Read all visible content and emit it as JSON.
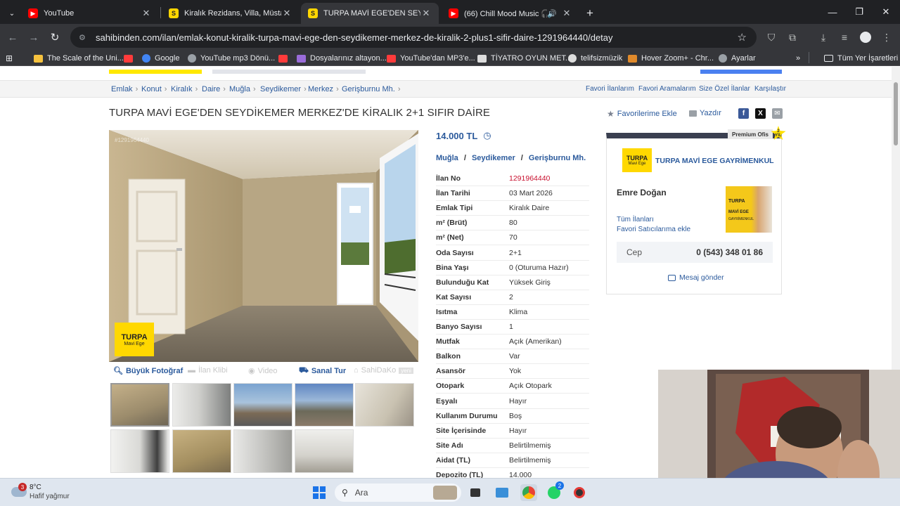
{
  "tabs": [
    {
      "title": "YouTube",
      "close": "✕"
    },
    {
      "title": "Kiralık Rezidans, Villa, Müstakil Ev",
      "close": "✕"
    },
    {
      "title": "TURPA MAVİ EGE'DEN SEYDİKEMER",
      "close": "✕"
    },
    {
      "title": "(66) Chill Mood Music 🎧 –",
      "close": "✕"
    }
  ],
  "new_tab": "+",
  "window_controls": {
    "minimize": "—",
    "restore": "❐",
    "close": "✕"
  },
  "address": {
    "url": "sahibinden.com/ilan/emlak-konut-kiralik-turpa-mavi-ege-den-seydikemer-merkez-de-kiralik-2-plus1-sifir-daire-1291964440/detay"
  },
  "bookmarks": [
    {
      "label": "The Scale of the Uni...",
      "color": "#f6c23e"
    },
    {
      "label": "Google",
      "color": "#4285f4"
    },
    {
      "label": "YouTube mp3 Dönü...",
      "color": "#9aa0a6"
    },
    {
      "label": "Dosyalarınız altayon...",
      "color": "#9a6cd9"
    },
    {
      "label": "YouTube'dan MP3'e...",
      "color": "#ff3b3b"
    },
    {
      "label": "TİYATRO OYUN MET...",
      "color": "#dddddd"
    },
    {
      "label": "telifsizmüzik",
      "color": "#dddddd"
    },
    {
      "label": "Hover Zoom+ - Chr...",
      "color": "#e08a2b"
    },
    {
      "label": "Ayarlar",
      "color": "#9aa0a6"
    }
  ],
  "bookmarks_more": "»",
  "all_bookmarks": "Tüm Yer İşaretleri",
  "breadcrumb": [
    "Emlak",
    "Konut",
    "Kiralık",
    "Daire",
    "Muğla",
    "Seydikemer",
    "Merkez",
    "Gerişburnu Mh."
  ],
  "crumb_sep": "›",
  "header_links": [
    "Favori İlanlarım",
    "Favori Aramalarım",
    "Size Özel İlanlar",
    "Karşılaştır"
  ],
  "listing": {
    "title": "TURPA MAVİ EGE'DEN SEYDİKEMER MERKEZ'DE KİRALIK 2+1 SIFIR DAİRE",
    "add_favorite": "Favorilerime Ekle",
    "print": "Yazdır",
    "price": "14.000 TL",
    "location": [
      "Muğla",
      "Seydikemer",
      "Gerişburnu Mh."
    ],
    "location_sep": "/",
    "photo_watermark": "#1291964440",
    "photo_logo": "TURPA",
    "photo_logo_sub": "Mavi Ege",
    "photo_tabs": [
      "Büyük Fotoğraf",
      "İlan Klibi",
      "Video",
      "Sanal Tur",
      "SahiDaKo",
      "yeni"
    ],
    "details": [
      {
        "k": "İlan No",
        "v": "1291964440"
      },
      {
        "k": "İlan Tarihi",
        "v": "03 Mart 2026"
      },
      {
        "k": "Emlak Tipi",
        "v": "Kiralık Daire"
      },
      {
        "k": "m² (Brüt)",
        "v": "80"
      },
      {
        "k": "m² (Net)",
        "v": "70"
      },
      {
        "k": "Oda Sayısı",
        "v": "2+1"
      },
      {
        "k": "Bina Yaşı",
        "v": "0 (Oturuma Hazır)"
      },
      {
        "k": "Bulunduğu Kat",
        "v": "Yüksek Giriş"
      },
      {
        "k": "Kat Sayısı",
        "v": "2"
      },
      {
        "k": "Isıtma",
        "v": "Klima"
      },
      {
        "k": "Banyo Sayısı",
        "v": "1"
      },
      {
        "k": "Mutfak",
        "v": "Açık (Amerikan)"
      },
      {
        "k": "Balkon",
        "v": "Var"
      },
      {
        "k": "Asansör",
        "v": "Yok"
      },
      {
        "k": "Otopark",
        "v": "Açık Otopark"
      },
      {
        "k": "Eşyalı",
        "v": "Hayır"
      },
      {
        "k": "Kullanım Durumu",
        "v": "Boş"
      },
      {
        "k": "Site İçerisinde",
        "v": "Hayır"
      },
      {
        "k": "Site Adı",
        "v": "Belirtilmemiş"
      },
      {
        "k": "Aidat (TL)",
        "v": "Belirtilmemiş"
      },
      {
        "k": "Depozito (TL)",
        "v": "14.000"
      }
    ]
  },
  "seller": {
    "badge": "Premium Ofis",
    "badge_years_num": "2",
    "badge_years_unit": "YIL",
    "logo_text": "TURPA",
    "logo_sub": "Mavi Ege",
    "office": "TURPA MAVİ EGE GAYRİMENKUL",
    "agent": "Emre Doğan",
    "all_listings": "Tüm İlanları",
    "add_fav_seller": "Favori Satıcılarıma ekle",
    "photo_caption": "TURPA",
    "photo_caption_2": "MAVİ EGE",
    "photo_caption_3": "GAYRİMENKUL",
    "phone_label": "Cep",
    "phone": "0 (543) 348 01 86",
    "message": "Mesaj gönder"
  },
  "taskbar": {
    "weather_temp": "8°C",
    "weather_desc": "Hafif yağmur",
    "weather_badge": "3",
    "search_placeholder": "Ara",
    "whatsapp_badge": "2"
  },
  "colors": {
    "link": "#2b5a9c",
    "brand_yellow": "#ffe800",
    "red": "#c8102e"
  }
}
